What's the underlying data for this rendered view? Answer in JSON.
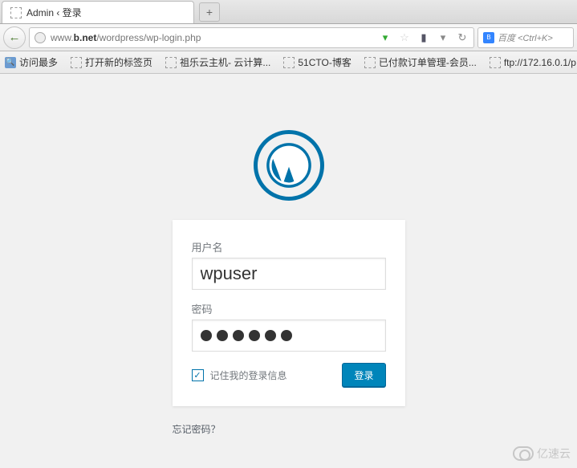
{
  "browser": {
    "tab_title": "Admin ‹ 登录",
    "url_prefix": "www.",
    "url_domain": "b.net",
    "url_path": "/wordpress/wp-login.php",
    "search_placeholder": "百度 <Ctrl+K>"
  },
  "bookmarks": [
    "访问最多",
    "打开新的标签页",
    "祖乐云主机- 云计算...",
    "51CTO-博客",
    "已付款订单管理-会员...",
    "ftp://172.16.0.1/p"
  ],
  "login": {
    "username_label": "用户名",
    "username_value": "wpuser",
    "password_label": "密码",
    "password_dots": 6,
    "remember_label": "记住我的登录信息",
    "remember_checked": true,
    "submit_label": "登录",
    "forgot_label": "忘记密码？"
  },
  "watermark": "亿速云"
}
